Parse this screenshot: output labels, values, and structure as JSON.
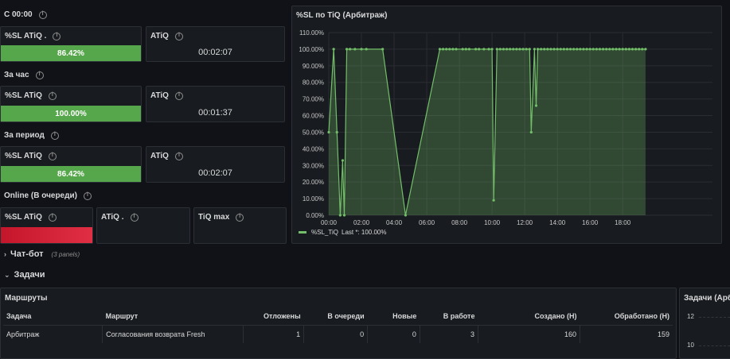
{
  "rows": {
    "since_midnight": "С 00:00",
    "last_hour": "За час",
    "period": "За период",
    "online": "Online (В очереди)"
  },
  "panels": {
    "sl1": {
      "title": "%SL ATiQ .",
      "value": "86.42%",
      "fraction": 0.8642
    },
    "atiq1": {
      "title": "ATiQ",
      "value": "00:02:07"
    },
    "sl2": {
      "title": "%SL ATiQ",
      "value": "100.00%",
      "fraction": 1.0
    },
    "atiq2": {
      "title": "ATiQ",
      "value": "00:01:37"
    },
    "sl3": {
      "title": "%SL ATiQ",
      "value": "86.42%",
      "fraction": 0.8642
    },
    "atiq3": {
      "title": "ATiQ",
      "value": "00:02:07"
    },
    "sl4": {
      "title": "%SL ATiQ",
      "color": "#e02f44"
    },
    "atiq4": {
      "title": "ATiQ ."
    },
    "tiqmax": {
      "title": "TiQ max"
    }
  },
  "colors": {
    "green": "#56a64b",
    "red": "#e02f44",
    "line": "#73bf69"
  },
  "chart_data": {
    "type": "line",
    "title": "%SL по TiQ (Арбитраж)",
    "ylim": [
      0,
      110
    ],
    "y_ticks": [
      "0.00%",
      "10.00%",
      "20.00%",
      "30.00%",
      "40.00%",
      "50.00%",
      "60.00%",
      "70.00%",
      "80.00%",
      "90.00%",
      "100.00%",
      "110.00%"
    ],
    "xlim": [
      0,
      23.5
    ],
    "x_ticks": [
      "00:00",
      "02:00",
      "04:00",
      "06:00",
      "08:00",
      "10:00",
      "12:00",
      "14:00",
      "16:00",
      "18:00"
    ],
    "grid": true,
    "legend_position": "bottom-left",
    "series": [
      {
        "name": "%SL_TiQ",
        "color": "#73bf69",
        "x": [
          0.0,
          0.3,
          0.5,
          0.7,
          0.85,
          0.95,
          1.1,
          1.3,
          1.6,
          2.0,
          2.3,
          3.3,
          4.7,
          6.8,
          7.0,
          7.2,
          7.4,
          7.6,
          7.8,
          8.2,
          8.4,
          8.6,
          9.0,
          9.2,
          9.5,
          9.8,
          10.0,
          10.1,
          10.3,
          10.5,
          10.7,
          10.9,
          11.1,
          11.3,
          11.5,
          11.7,
          11.9,
          12.1,
          12.3,
          12.4,
          12.6,
          12.7,
          12.8,
          13.0,
          13.2,
          13.4,
          13.6,
          13.8,
          14.0,
          14.2,
          14.4,
          14.6,
          14.8,
          15.0,
          15.2,
          15.4,
          15.6,
          15.8,
          16.0,
          16.2,
          16.4,
          16.6,
          16.8,
          17.0,
          17.2,
          17.4,
          17.6,
          17.8,
          18.0,
          18.2,
          18.4,
          18.6,
          18.8,
          19.0,
          19.2,
          19.4
        ],
        "y": [
          50,
          100,
          50,
          0,
          33,
          0,
          100,
          100,
          100,
          100,
          100,
          100,
          0,
          100,
          100,
          100,
          100,
          100,
          100,
          100,
          100,
          100,
          100,
          100,
          100,
          100,
          100,
          9,
          100,
          100,
          100,
          100,
          100,
          100,
          100,
          100,
          100,
          100,
          100,
          50,
          100,
          66,
          100,
          100,
          100,
          100,
          100,
          100,
          100,
          100,
          100,
          100,
          100,
          100,
          100,
          100,
          100,
          100,
          100,
          100,
          100,
          100,
          100,
          100,
          100,
          100,
          100,
          100,
          100,
          100,
          100,
          100,
          100,
          100,
          100,
          100
        ]
      }
    ],
    "legend_label": "%SL_TiQ",
    "legend_stat": "Last *: 100.00%"
  },
  "sections": {
    "chatbot": {
      "title": "Чат-бот",
      "note": "(3 panels)"
    },
    "tasks": {
      "title": "Задачи"
    }
  },
  "routes": {
    "title": "Маршруты",
    "headers": [
      "Задача",
      "Маршрут",
      "Отложены",
      "В очереди",
      "Новые",
      "В работе",
      "Создано (Н)",
      "Обработано (Н)"
    ],
    "rows": [
      [
        "Арбитраж",
        "Согласования возврата Fresh",
        "1",
        "0",
        "0",
        "3",
        "160",
        "159"
      ]
    ]
  },
  "right_panel": {
    "title": "Задачи (Арб",
    "y_ticks": [
      "12",
      "10"
    ]
  }
}
